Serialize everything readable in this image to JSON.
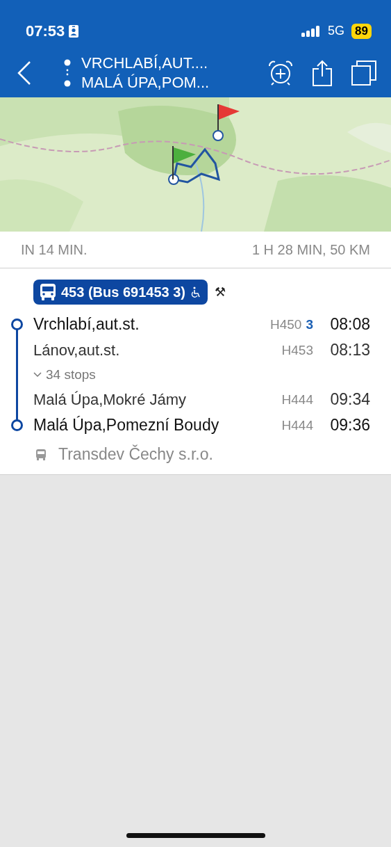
{
  "status_bar": {
    "time": "07:53",
    "network": "5G",
    "battery": "89"
  },
  "nav": {
    "from": "VRCHLABÍ,AUT....",
    "to": "MALÁ ÚPA,POM..."
  },
  "summary": {
    "departure": "IN 14 MIN.",
    "duration": "1 H 28 MIN, 50 KM"
  },
  "trip": {
    "line": "453 (Bus 691453 3)",
    "wheelchair": true,
    "extra_symbol": "⚒",
    "stops": [
      {
        "kind": "stop",
        "name": "Vrchlabí,aut.st.",
        "platform": "H450",
        "track": "3",
        "time": "08:08",
        "endpoint": true
      },
      {
        "kind": "stop",
        "name": "Lánov,aut.st.",
        "platform": "H453",
        "time": "08:13",
        "endpoint": false
      },
      {
        "kind": "toggle",
        "label": "34 stops",
        "expanded": false
      },
      {
        "kind": "stop",
        "name": "Malá Úpa,Mokré Jámy",
        "platform": "H444",
        "time": "09:34",
        "endpoint": false
      },
      {
        "kind": "stop",
        "name": "Malá Úpa,Pomezní Boudy",
        "platform": "H444",
        "time": "09:36",
        "endpoint": true
      }
    ],
    "operator": "Transdev Čechy s.r.o."
  }
}
